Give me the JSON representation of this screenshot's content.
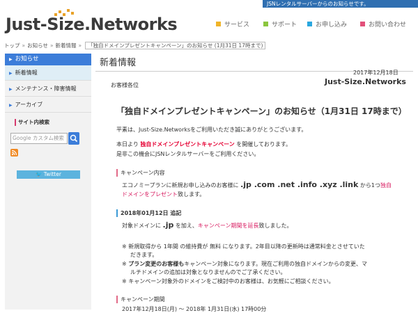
{
  "topbar": {
    "text": "JSNレンタルサーバーからのお知らせです。"
  },
  "logo": {
    "text": "Just-Size.Networks"
  },
  "gnav": {
    "items": [
      {
        "label": "サービス",
        "color": "#f0b429"
      },
      {
        "label": "サポート",
        "color": "#8cc63f"
      },
      {
        "label": "お申し込み",
        "color": "#2aa7df"
      },
      {
        "label": "お問い合わせ",
        "color": "#e2507a"
      }
    ]
  },
  "breadcrumb": {
    "home": "トップ",
    "news": "お知らせ",
    "category": "新着情報",
    "current": "「独自ドメインプレゼントキャンペーン」のお知らせ (1月31日 17時まで)",
    "sep": "»"
  },
  "sidebar": {
    "header": "お知らせ",
    "items": [
      {
        "label": "新着情報"
      },
      {
        "label": "メンテナンス・障害情報"
      },
      {
        "label": "アーカイブ"
      }
    ],
    "search_label": "サイト内検索",
    "search_placeholder": "Google カスタム検索",
    "twitter": "Twitter"
  },
  "main": {
    "heading": "新着情報",
    "date": "2017年12月18日",
    "salutation": "お客様各位",
    "company": "Just-Size.Networks",
    "title": "「独自ドメインプレゼントキャンペーン」のお知らせ（1月31日 17時まで）",
    "p1": "平素は、Just-Size.Networksをご利用いただき誠にありがとうございます。",
    "p2a": "本日より",
    "p2b": "独自ドメインプレゼントキャンペーン",
    "p2c": "を開催しております。",
    "p3": "是非この機会にJSNレンタルサーバーをご利用ください。",
    "sec1": "キャンペーン内容",
    "c1a": "エコノミープランに新規お申し込みのお客様に",
    "c1b": ".jp .com .net .info .xyz .link",
    "c1c": "から1つ",
    "c1d": "独自",
    "c2": "ドメインをプレゼント",
    "c2b": "致します。",
    "sec2": "2018年01月12日 追記",
    "a1a": "対象ドメインに",
    "a1b": ".jp",
    "a1c": "を加え、",
    "a1d": "キャンペーン期間を延長",
    "a1e": "致しました。",
    "n1": "※ 新規取得から 1年間 の維持費が 無料 になります。2年目以降の更新時は通常料金とさせていた",
    "n1b": "だきます。",
    "n2a": "※ ",
    "n2b": "プラン変更のお客様も",
    "n2c": "キャンペーン対象になります。現在ご利用の独自ドメインからの変更、マ",
    "n2d": "ルチドメインの追加は対象となりませんのでご了承ください。",
    "n3": "※ キャンペーン対象外のドメインをご検討中のお客様は、お気軽にご相談ください。",
    "sec3": "キャンペーン期間",
    "period": "2017年12月18日(月) 〜 2018年 1月31日(水) 17時00分"
  }
}
